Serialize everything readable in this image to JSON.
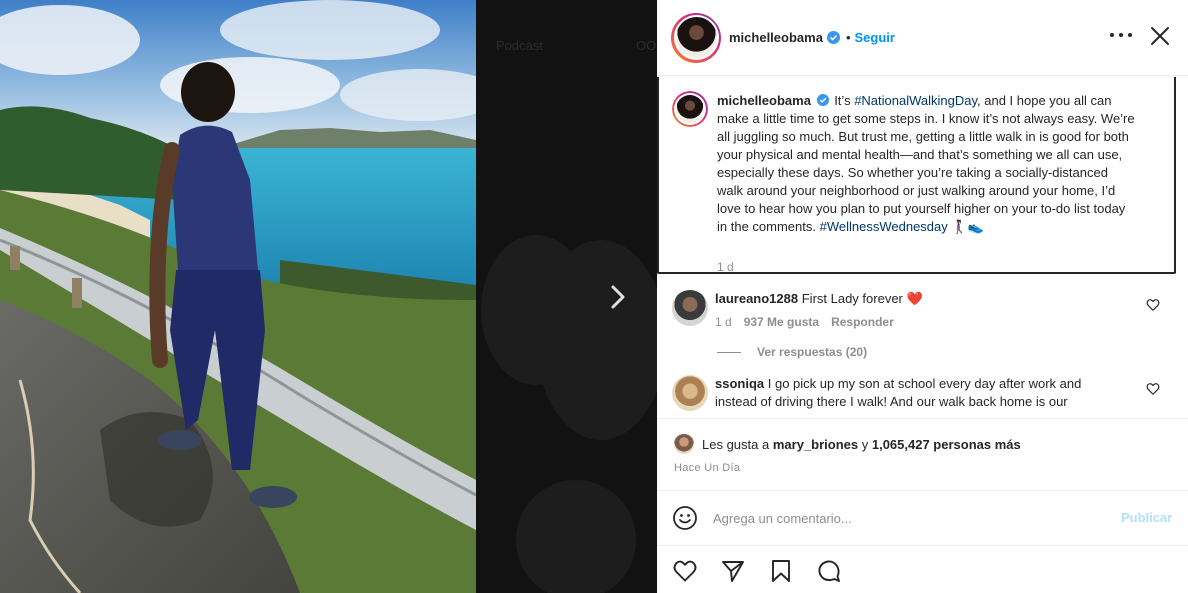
{
  "backdrop": {
    "ghost_tabs": [
      "Podcast",
      "OO"
    ]
  },
  "post": {
    "username": "michelleobama",
    "follow_label": "Seguir",
    "separator": "•",
    "caption": {
      "username": "michelleobama",
      "segments": [
        {
          "text": "It’s ",
          "type": "text"
        },
        {
          "text": "#NationalWalkingDay",
          "type": "hashtag"
        },
        {
          "text": ", and I hope you all can make a little time to get some steps in. I know it’s not always easy. We’re all juggling so much. But trust me, getting a little walk in is good for both your physical and mental health—and that’s something we all can use, especially these days. So whether you’re taking a socially-distanced walk around your neighborhood or just walking around your home, I’d love to hear how you plan to put yourself higher on your to-do list today in the comments. ",
          "type": "text"
        },
        {
          "text": "#WellnessWednesday",
          "type": "hashtag"
        },
        {
          "text": " 🚶🏾‍♀️👟",
          "type": "text"
        }
      ],
      "time": "1 d"
    },
    "comments": [
      {
        "username": "laureano1288",
        "text": "First Lady forever",
        "emoji": "❤️",
        "time": "1 d",
        "likes": "937 Me gusta",
        "reply_label": "Responder",
        "view_replies": "Ver respuestas (20)"
      },
      {
        "username": "ssoniqa",
        "text": "I go pick up my son at school every day after work and instead of driving there I walk! And our walk back home is our special moment of the day. Love it.",
        "visible_text": "I go pick up my son at school every day after work and instead of driving there I walk! And our walk back home is our"
      }
    ],
    "likes": {
      "prefix": "Les gusta a",
      "first_user": "mary_briones",
      "joiner": "y",
      "others": "1,065,427 personas más"
    },
    "timestamp": "Hace Un Día",
    "comment_box": {
      "placeholder": "Agrega un comentario...",
      "publish_label": "Publicar"
    }
  },
  "colors": {
    "accent": "#0095f6",
    "hashtag": "#00376b",
    "publish_disabled": "#b2dffc",
    "heart_red": "#ed4956"
  },
  "icons": [
    "more-icon",
    "close-icon",
    "verified-icon",
    "heart-icon",
    "comment-icon",
    "share-icon",
    "bookmark-icon",
    "emoji-icon",
    "chevron-right-icon"
  ]
}
